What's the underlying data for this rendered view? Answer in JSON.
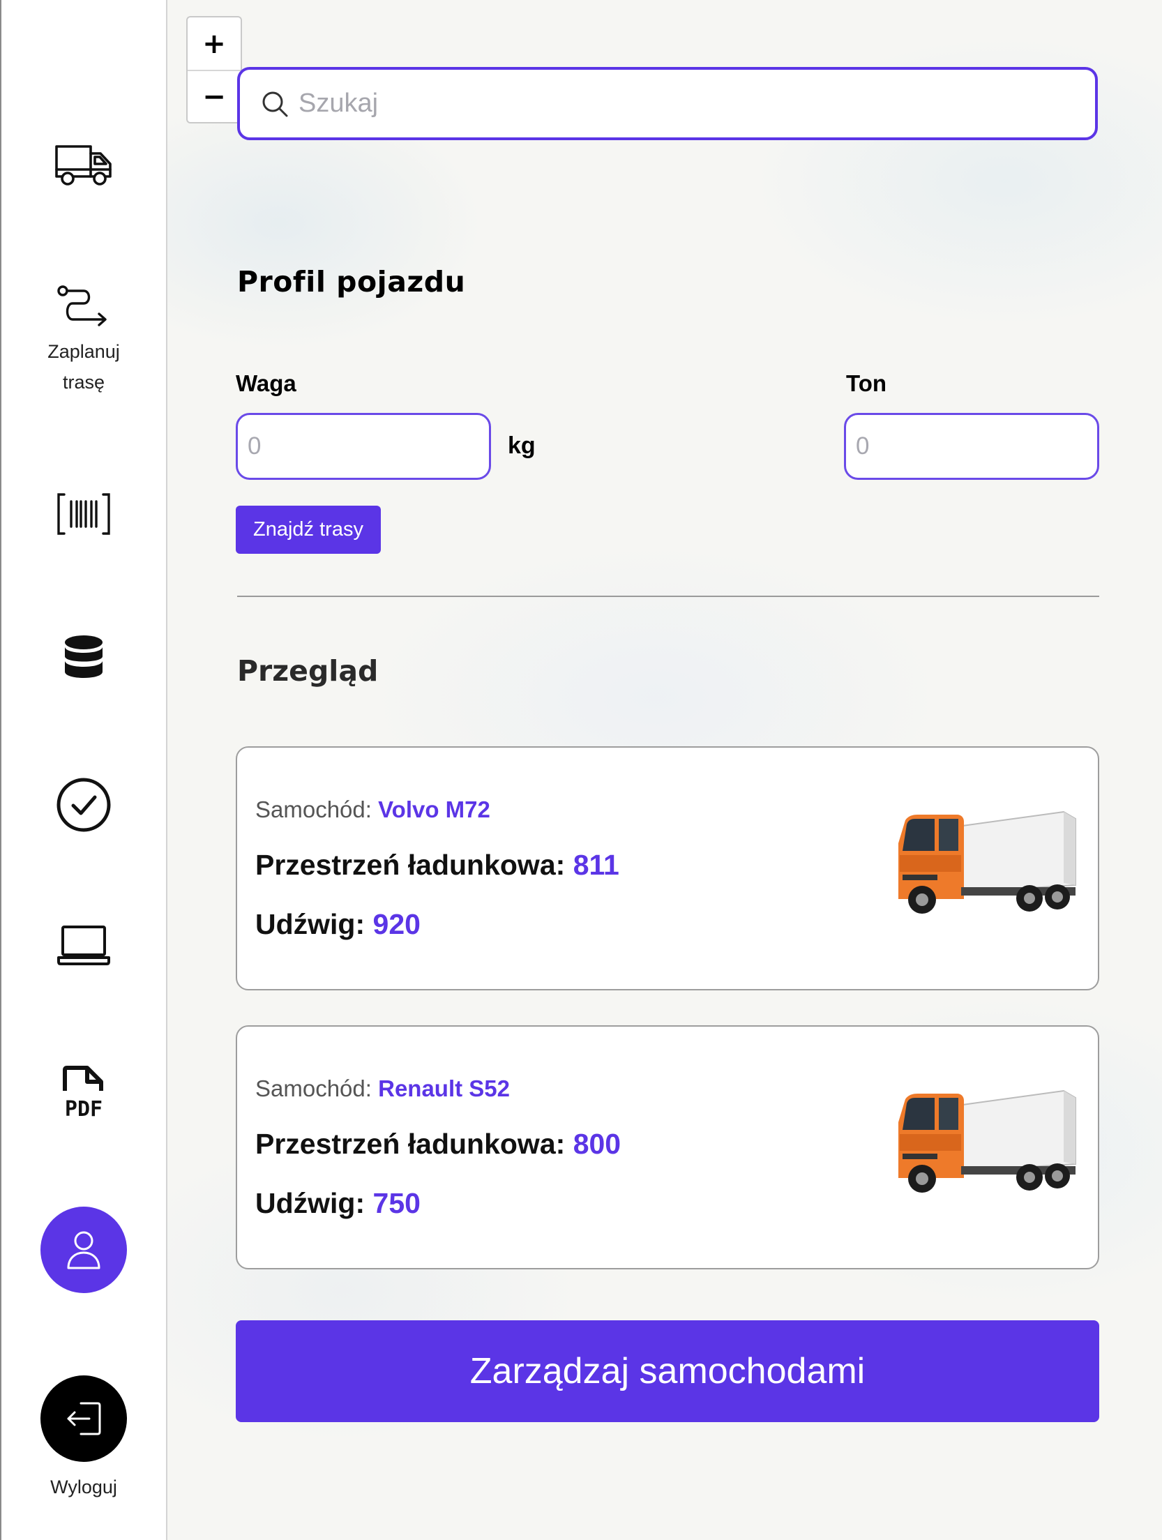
{
  "sidebar": {
    "items": [
      {
        "icon": "truck-icon"
      },
      {
        "icon": "route-icon",
        "label": "Zaplanuj\ntrasę"
      },
      {
        "icon": "barcode-icon"
      },
      {
        "icon": "database-icon"
      },
      {
        "icon": "check-circle-icon"
      },
      {
        "icon": "laptop-icon"
      },
      {
        "icon": "pdf-icon"
      },
      {
        "icon": "user-icon"
      },
      {
        "icon": "logout-icon",
        "label": "Wyloguj"
      }
    ],
    "profile_color": "#5b35e6",
    "logout_color": "#000000"
  },
  "map": {
    "zoom_in": "+",
    "zoom_out": "−"
  },
  "search": {
    "placeholder": "Szukaj"
  },
  "profile": {
    "title": "Profil pojazdu",
    "weight_label": "Waga",
    "weight_value": "",
    "weight_placeholder": "0",
    "weight_unit": "kg",
    "ton_label": "Ton",
    "ton_value": "",
    "ton_placeholder": "0",
    "find_routes": "Znajdź trasy"
  },
  "overview": {
    "title": "Przegląd",
    "cards": [
      {
        "car_label": "Samochód:",
        "car_name": "Volvo M72",
        "cargo_label": "Przestrzeń ładunkowa:",
        "cargo_value": "811",
        "capacity_label": "Udźwig:",
        "capacity_value": "920",
        "image": "orange-truck-photo"
      },
      {
        "car_label": "Samochód:",
        "car_name": "Renault S52",
        "cargo_label": "Przestrzeń ładunkowa:",
        "cargo_value": "800",
        "capacity_label": "Udźwig:",
        "capacity_value": "750",
        "image": "orange-truck-photo"
      }
    ]
  },
  "manage_button": "Zarządzaj samochodami",
  "accent_color": "#5b35e6"
}
